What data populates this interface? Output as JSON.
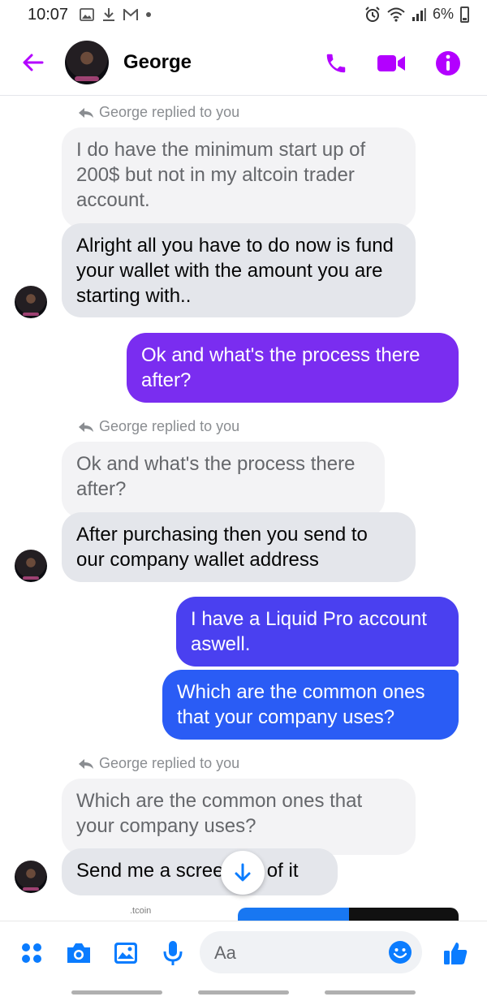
{
  "status_bar": {
    "time": "10:07",
    "battery": "6%",
    "notif_icons": [
      "image-icon",
      "download-icon",
      "gmail-icon",
      "dot-icon"
    ],
    "right_icons": [
      "alarm-icon",
      "wifi-icon",
      "signal-icon",
      "battery-icon"
    ]
  },
  "header": {
    "contact_name": "George",
    "accent": "#b300ff"
  },
  "messages": {
    "reply_note_1": "George replied to you",
    "quoted_1": "I do have the minimum start up of 200$ but not in my altcoin trader account.",
    "recv_1": "Alright all you have to do now is fund your wallet with the amount you are starting with..",
    "sent_1": "Ok and what's the process there after?",
    "reply_note_2": "George replied to you",
    "quoted_2": "Ok and what's the process there after?",
    "recv_2": "After purchasing then you send to our company wallet address",
    "sent_2": "I have a Liquid Pro account aswell.",
    "sent_3": "Which are the common ones that your company uses?",
    "reply_note_3": "George replied to you",
    "quoted_3": "Which are the common ones that your company uses?",
    "recv_3": "Send me a scree  hot of it",
    "preview_caption": ".tcoin"
  },
  "colors": {
    "sent_purple": "#7a2df0",
    "sent_blue": "#2a5cf5",
    "received_bg": "#e4e6eb",
    "quoted_bg": "#f3f3f5",
    "icon_blue": "#0a7cff"
  },
  "composer": {
    "placeholder": "Aa",
    "icons": [
      "apps-icon",
      "camera-icon",
      "gallery-icon",
      "mic-icon",
      "emoji-icon",
      "like-icon"
    ]
  }
}
